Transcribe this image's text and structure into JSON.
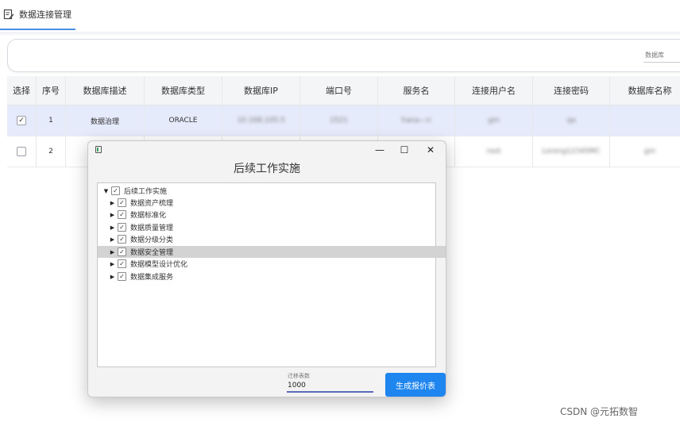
{
  "tabbar": {
    "tab_label": "数据连接管理",
    "tab_icon": "edit-document-icon"
  },
  "filter": {
    "label": "数据库"
  },
  "table": {
    "headers": [
      "选择",
      "序号",
      "数据库描述",
      "数据库类型",
      "数据库IP",
      "端口号",
      "服务名",
      "连接用户名",
      "连接密码",
      "数据库名称"
    ],
    "rows": [
      {
        "checked": true,
        "check_mark": "✓",
        "cells": [
          "1",
          "数据治理",
          "ORACLE",
          "10.168.105.5",
          "1521",
          "hana—n",
          "gm",
          "qa",
          ""
        ]
      },
      {
        "checked": false,
        "check_mark": "",
        "cells": [
          "2",
          "",
          "",
          "",
          "",
          "",
          "root",
          "Lorong12345MC",
          "gm"
        ]
      }
    ]
  },
  "dialog": {
    "title": "后续工作实施",
    "window_controls": {
      "minimize": "—",
      "maximize": "☐",
      "close": "✕"
    },
    "tree": {
      "root": {
        "label": "后续工作实施",
        "expanded": true,
        "checked": true
      },
      "children": [
        {
          "label": "数据资产梳理",
          "checked": true,
          "highlighted": false
        },
        {
          "label": "数据标准化",
          "checked": true,
          "highlighted": false
        },
        {
          "label": "数据质量管理",
          "checked": true,
          "highlighted": false
        },
        {
          "label": "数据分级分类",
          "checked": true,
          "highlighted": false
        },
        {
          "label": "数据安全管理",
          "checked": true,
          "highlighted": true
        },
        {
          "label": "数据模型设计优化",
          "checked": true,
          "highlighted": false
        },
        {
          "label": "数据集成服务",
          "checked": true,
          "highlighted": false
        }
      ]
    },
    "field": {
      "label": "迁移表数",
      "value": "1000"
    },
    "generate_button": "生成报价表"
  },
  "watermark": "CSDN @元拓数智",
  "colors": {
    "accent": "#1f86f0",
    "selected_row": "#e6ebfb",
    "tree_highlight": "#d3d3d3",
    "input_underline": "#5a6ab8"
  }
}
